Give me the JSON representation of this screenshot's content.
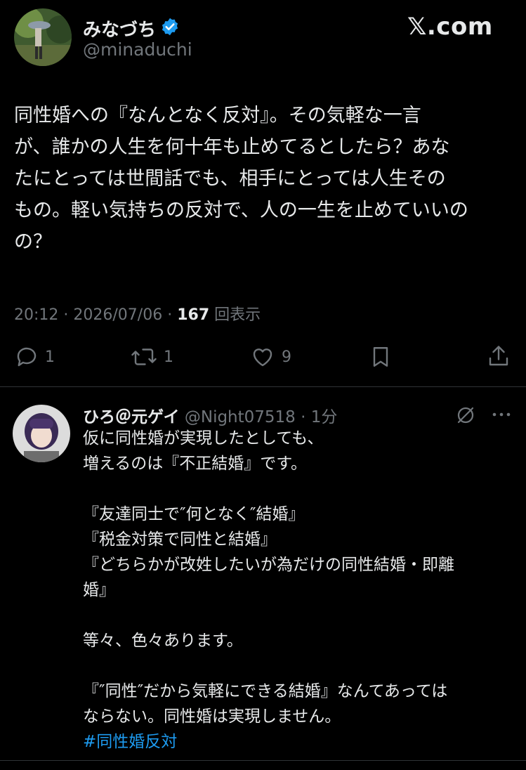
{
  "brand": {
    "logo_text": "𝕏.com"
  },
  "tweet": {
    "author_name": "みなづち",
    "author_handle": "@minaduchi",
    "verified": true,
    "body_lines": [
      "同性婚への『なんとなく反対』。その気軽な一言",
      "が、誰かの人生を何十年も止めてるとしたら？あな",
      "たにとっては世間話でも、相手にとっては人生その",
      "もの。軽い気持ちの反対で、人の一生を止めていいの",
      "の？"
    ],
    "time": "20:12",
    "date": "2026/07/06",
    "views_count": "167",
    "views_label": "回表示",
    "replies": "1",
    "reposts": "1",
    "likes": "9"
  },
  "reply": {
    "author_name": "ひろ＠元ゲイ",
    "author_handle": "@Night07518",
    "time_ago": "1分",
    "lines": [
      "仮に同性婚が実現したとしても、",
      "増えるのは『不正結婚』です。",
      "",
      "『友達同士で″何となく″結婚』",
      "『税金対策で同性と結婚』",
      "『どちらかが改姓したいが為だけの同性結婚・即離",
      "婚』",
      "",
      "等々、色々あります。",
      "",
      "『″同性″だから気軽にできる結婚』なんてあっては",
      "ならない。同性婚は実現しません。"
    ],
    "hashtag": "#同性婚反対"
  },
  "colors": {
    "background": "#000000",
    "text": "#e7e9ea",
    "muted": "#71767b",
    "accent": "#1d9bf0",
    "divider": "#2f3336"
  },
  "icons": [
    "reply-icon",
    "repost-icon",
    "like-icon",
    "bookmark-icon",
    "share-icon",
    "verified-badge-icon",
    "grok-icon",
    "more-icon"
  ]
}
